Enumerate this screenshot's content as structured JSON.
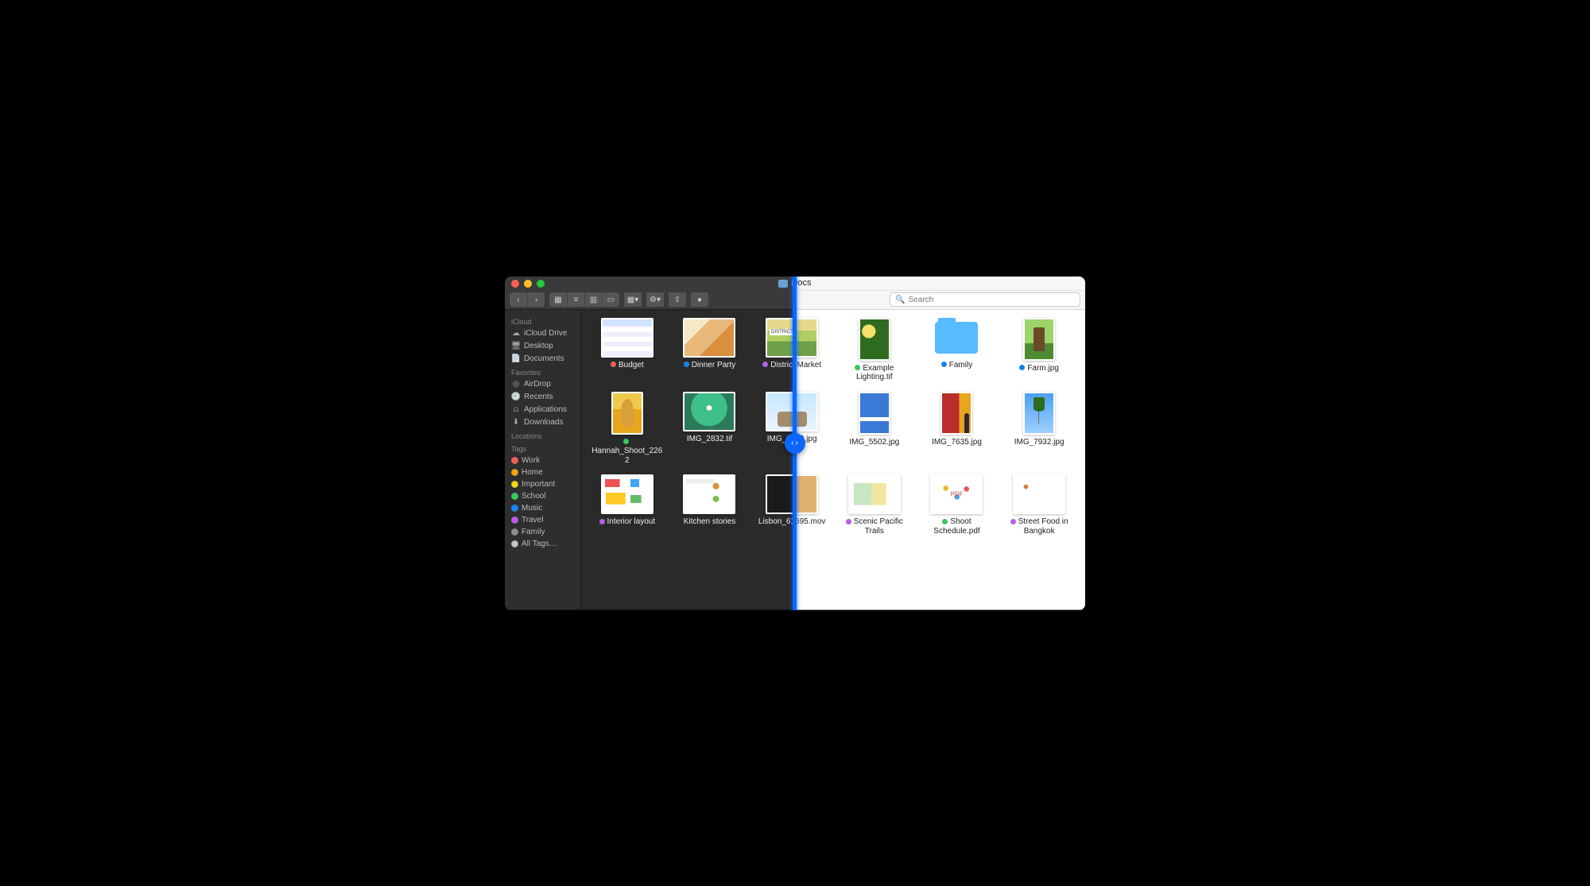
{
  "window": {
    "title": "Docs"
  },
  "toolbar": {
    "back_aria": "Back",
    "fwd_aria": "Forward",
    "view_icon": "icon-view",
    "view_list": "list-view",
    "view_col": "column-view",
    "view_gal": "gallery-view",
    "arrange": "arrange",
    "action": "action-menu",
    "share": "share",
    "tags_btn": "edit-tags"
  },
  "search": {
    "placeholder": "Search"
  },
  "sidebar": {
    "sections": [
      {
        "header": "iCloud",
        "items": [
          {
            "icon": "cloud",
            "label": "iCloud Drive"
          },
          {
            "icon": "desktop",
            "label": "Desktop"
          },
          {
            "icon": "doc",
            "label": "Documents"
          }
        ]
      },
      {
        "header": "Favorites",
        "items": [
          {
            "icon": "airdrop",
            "label": "AirDrop"
          },
          {
            "icon": "clock",
            "label": "Recents"
          },
          {
            "icon": "apps",
            "label": "Applications"
          },
          {
            "icon": "down",
            "label": "Downloads"
          }
        ]
      },
      {
        "header": "Locations",
        "items": []
      },
      {
        "header": "Tags",
        "items": [
          {
            "tagColor": "#ff5a52",
            "label": "Work"
          },
          {
            "tagColor": "#ff9f0a",
            "label": "Home"
          },
          {
            "tagColor": "#ffd60a",
            "label": "Important"
          },
          {
            "tagColor": "#30d158",
            "label": "School"
          },
          {
            "tagColor": "#0a84ff",
            "label": "Music"
          },
          {
            "tagColor": "#bf5af2",
            "label": "Travel"
          },
          {
            "tagColor": "#8e8e93",
            "label": "Family"
          },
          {
            "tagColor": "#c7c7cc",
            "label": "All Tags…"
          }
        ]
      }
    ]
  },
  "files": [
    {
      "name": "Budget",
      "tag": "#ff5a52",
      "art": "grid",
      "shape": "land"
    },
    {
      "name": "Dinner Party",
      "tag": "#0a84ff",
      "art": "food",
      "shape": "land"
    },
    {
      "name": "District Market",
      "tag": "#bf5af2",
      "art": "market",
      "shape": "land"
    },
    {
      "name": "Example Lighting.tif",
      "tag": "#30d158",
      "art": "leaves",
      "shape": "port"
    },
    {
      "name": "Family",
      "tag": "#0a84ff",
      "art": "folder",
      "shape": "folder"
    },
    {
      "name": "Farm.jpg",
      "tag": "#0a84ff",
      "art": "farm",
      "shape": "port"
    },
    {
      "name": "Hannah_Shoot_2262",
      "tag": "#30d158",
      "art": "woman",
      "shape": "port"
    },
    {
      "name": "IMG_2832.tif",
      "tag": null,
      "art": "umbrella",
      "shape": "land"
    },
    {
      "name": "IMG_2869.jpg",
      "tag": null,
      "art": "bicycle",
      "shape": "land"
    },
    {
      "name": "IMG_5502.jpg",
      "tag": null,
      "art": "sky",
      "shape": "port"
    },
    {
      "name": "IMG_7635.jpg",
      "tag": null,
      "art": "wall",
      "shape": "port"
    },
    {
      "name": "IMG_7932.jpg",
      "tag": null,
      "art": "palms",
      "shape": "port"
    },
    {
      "name": "Interior layout",
      "tag": "#bf5af2",
      "art": "layout",
      "shape": "land"
    },
    {
      "name": "Kitchen stories",
      "tag": null,
      "art": "kitchen",
      "shape": "land"
    },
    {
      "name": "Lisbon_61695.mov",
      "tag": null,
      "art": "video",
      "shape": "land"
    },
    {
      "name": "Scenic Pacific Trails",
      "tag": "#bf5af2",
      "art": "mappdf",
      "shape": "land"
    },
    {
      "name": "Shoot Schedule.pdf",
      "tag": "#30d158",
      "art": "schedule",
      "shape": "land"
    },
    {
      "name": "Street Food in Bangkok",
      "tag": "#bf5af2",
      "art": "streetfood",
      "shape": "land"
    }
  ],
  "glyphs": {
    "back": "‹",
    "fwd": "›",
    "icon": "▦",
    "list": "≡",
    "col": "▥",
    "gal": "▭",
    "arrange": "▦▾",
    "gear": "⚙︎▾",
    "share": "⇪",
    "tag": "●",
    "cloud": "☁︎",
    "desktop": "🖥",
    "doc": "📄",
    "airdrop": "◎",
    "clock": "🕘",
    "apps": "⩍",
    "down": "⬇︎",
    "search": "🔍",
    "caret_l": "‹",
    "caret_r": "›"
  }
}
